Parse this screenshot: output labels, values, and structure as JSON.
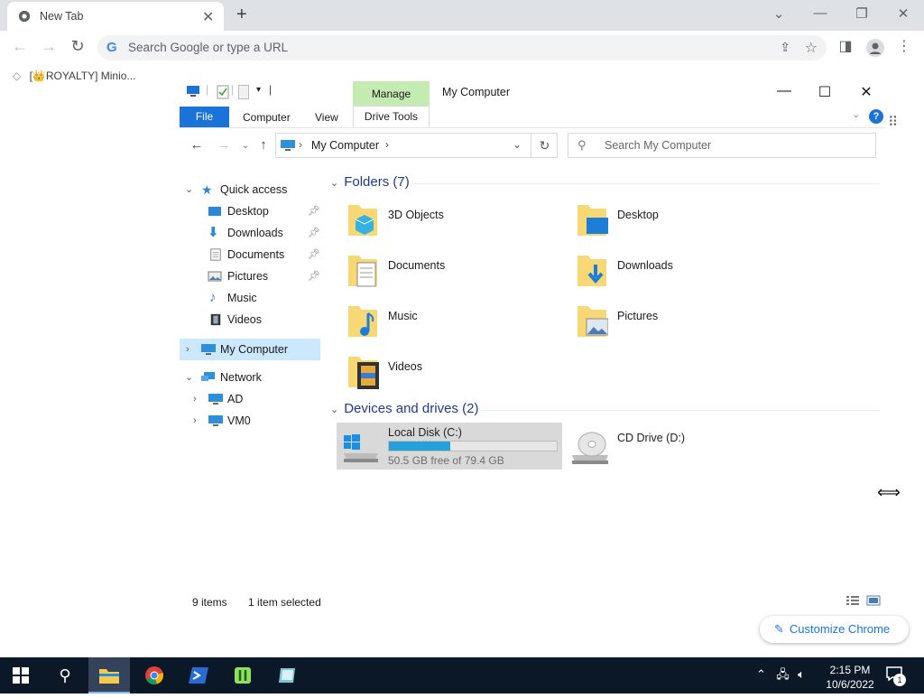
{
  "chrome": {
    "tab_title": "New Tab",
    "tab_close": "✕",
    "new_tab": "+",
    "omnibox_placeholder": "Search Google or type a URL",
    "bookmark_label": "[👑ROYALTY] Minio...",
    "customize_label": "Customize Chrome"
  },
  "explorer": {
    "window_title": "My Computer",
    "manage_tab": "Manage",
    "ribbon_tabs": {
      "file": "File",
      "computer": "Computer",
      "view": "View",
      "drive_tools": "Drive Tools"
    },
    "address_location": "My Computer",
    "search_placeholder": "Search My Computer",
    "nav": {
      "quick_access": "Quick access",
      "quick_items": [
        "Desktop",
        "Downloads",
        "Documents",
        "Pictures",
        "Music",
        "Videos"
      ],
      "my_computer": "My Computer",
      "network": "Network",
      "network_items": [
        "AD",
        "VM0"
      ]
    },
    "folders_header": "Folders (7)",
    "folders": [
      "3D Objects",
      "Desktop",
      "Documents",
      "Downloads",
      "Music",
      "Pictures",
      "Videos"
    ],
    "devices_header": "Devices and drives (2)",
    "drive_c": {
      "name": "Local Disk (C:)",
      "free_text": "50.5 GB free of 79.4 GB",
      "used_fraction": 0.364
    },
    "drive_d": {
      "name": "CD Drive (D:)"
    },
    "status": {
      "items": "9 items",
      "selected": "1 item selected"
    }
  },
  "taskbar": {
    "time": "2:15 PM",
    "date": "10/6/2022",
    "notification_count": "1"
  },
  "colors": {
    "accent": "#1a73d9",
    "manage_tab": "#c4ebb2",
    "selection": "#cce8ff",
    "taskbar": "#0b1828"
  }
}
